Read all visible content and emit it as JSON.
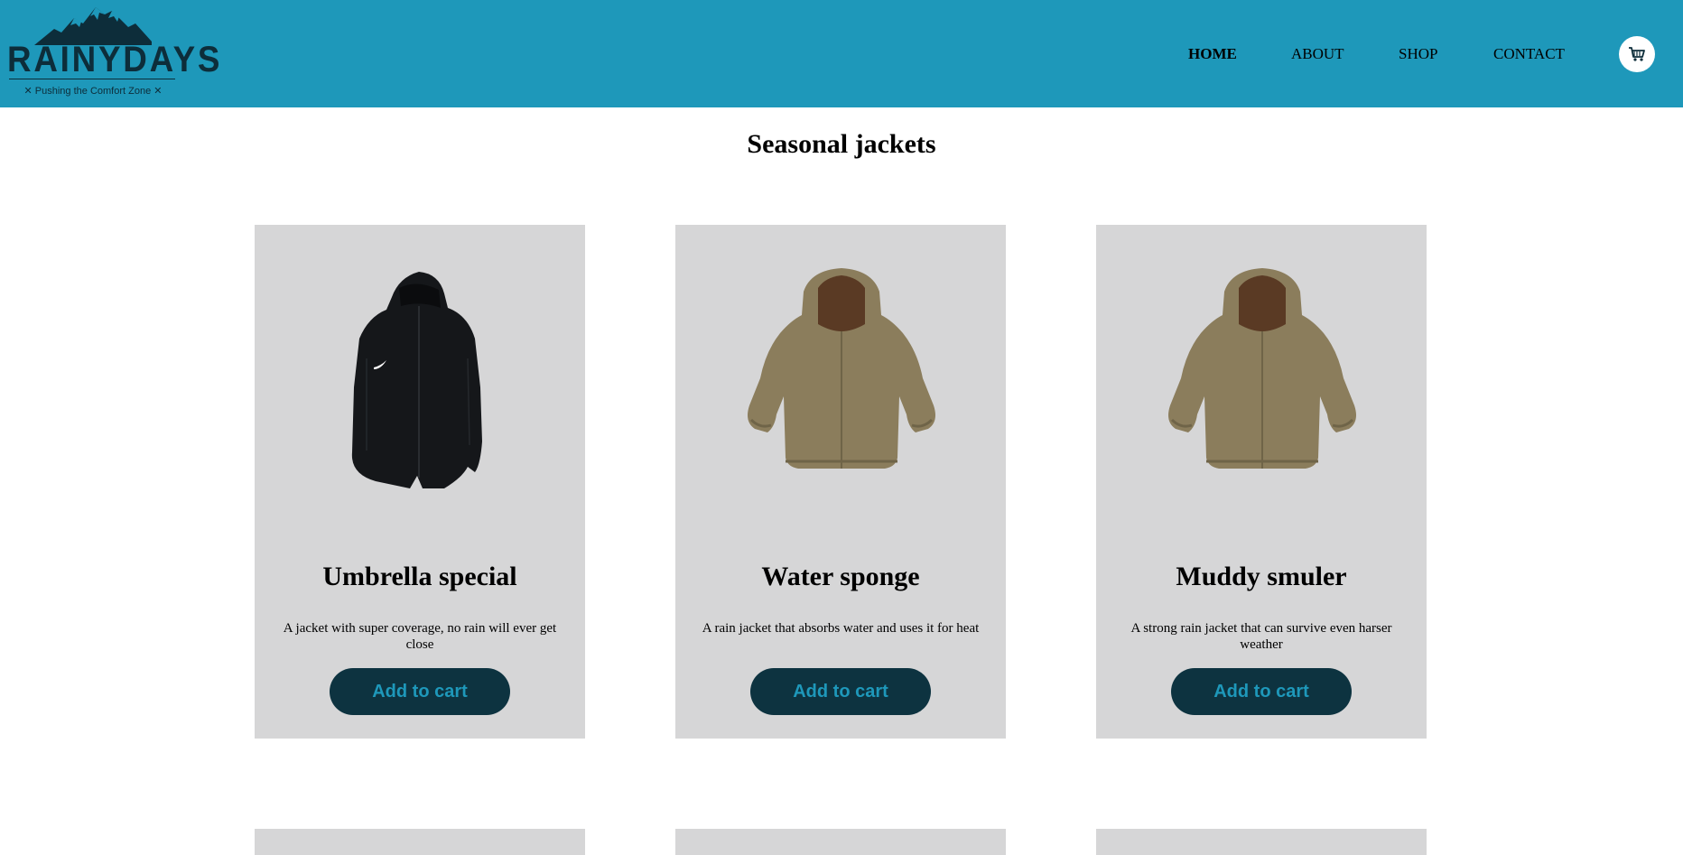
{
  "brand": {
    "name": "RAINYDAYS",
    "tagline": "✕ Pushing the Comfort Zone ✕",
    "logo_icon": "mountain-icon"
  },
  "nav": {
    "items": [
      {
        "label": "HOME",
        "active": true
      },
      {
        "label": "ABOUT",
        "active": false
      },
      {
        "label": "SHOP",
        "active": false
      },
      {
        "label": "CONTACT",
        "active": false
      }
    ],
    "cart_icon": "shopping-cart-icon"
  },
  "page": {
    "title": "Seasonal jackets"
  },
  "products": [
    {
      "name": "Umbrella special",
      "description": "A jacket with super coverage, no rain will ever get close",
      "button": "Add to cart",
      "image": "black-jacket"
    },
    {
      "name": "Water sponge",
      "description": "A rain jacket that absorbs water and uses it for heat",
      "button": "Add to cart",
      "image": "olive-jacket"
    },
    {
      "name": "Muddy smuler",
      "description": "A strong rain jacket that can survive even harser weather",
      "button": "Add to cart",
      "image": "olive-jacket"
    }
  ],
  "colors": {
    "header_bg": "#1e98ba",
    "logo_dark": "#0d2d3a",
    "card_bg": "#d6d6d7",
    "button_bg": "#0d3340",
    "button_text": "#1e98ba"
  }
}
